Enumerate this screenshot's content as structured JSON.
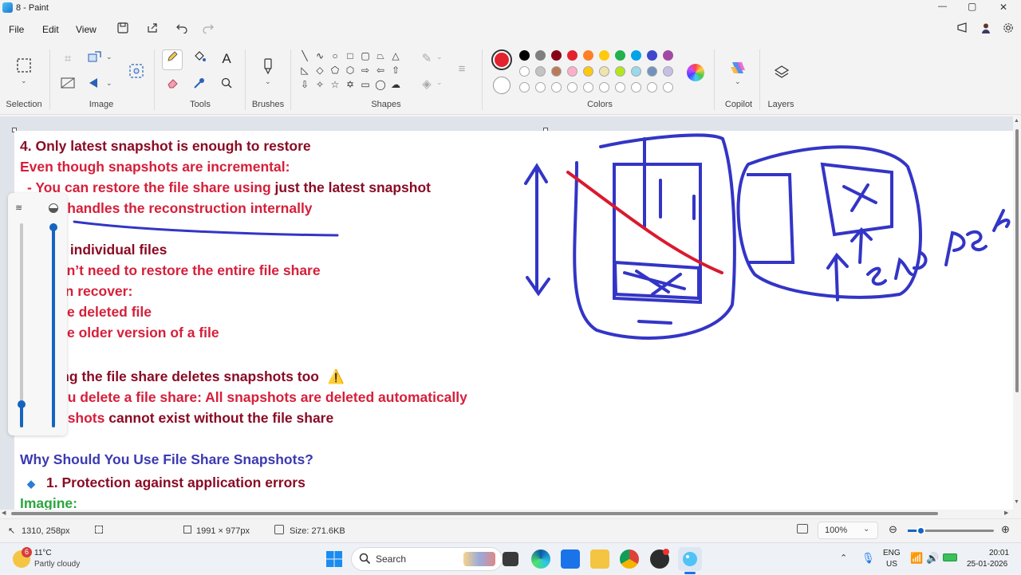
{
  "app": {
    "title": "8 - Paint"
  },
  "window_controls": {
    "minimize": "—",
    "maximize": "▢",
    "close": "✕"
  },
  "menu": {
    "file": "File",
    "edit": "Edit",
    "view": "View"
  },
  "ribbon": {
    "groups": {
      "selection": "Selection",
      "image": "Image",
      "tools": "Tools",
      "brushes": "Brushes",
      "shapes": "Shapes",
      "colors": "Colors",
      "copilot": "Copilot",
      "layers": "Layers"
    },
    "active_color": "#e3222e",
    "palette_row1": [
      "#000000",
      "#7f7f7f",
      "#880015",
      "#e3222e",
      "#ff7f27",
      "#ffc90e",
      "#22b14c",
      "#00a2e8",
      "#3f48cc",
      "#a349a4"
    ],
    "palette_row2": [
      "#ffffff",
      "#c3c3c3",
      "#b97a57",
      "#ffaec9",
      "#ffc90e",
      "#efe4b0",
      "#b5e61d",
      "#99d9ea",
      "#7092be",
      "#c8bfe7"
    ]
  },
  "canvas_text": {
    "l1": "4. Only latest snapshot is enough to restore",
    "l2": "Even though snapshots are incremental:",
    "l3a": "- You can restore the file share using",
    "l3b": " just the latest snapshot",
    "l4": "A    re handles the reconstruction internally",
    "l5": "I      ore individual files",
    "l6": "Y     don’t need to restore the entire file share",
    "l7": "Y     can recover:",
    "l8": "e deleted file",
    "l9": "e older version of a file",
    "l10": "I      eting the file share deletes snapshots too",
    "l10_icon": "⚠️",
    "l11": "ou delete a file share: All snapshots are deleted automatically",
    "l12a": "pshots",
    "l12b": " cannot exist without the file share",
    "l13": "Why Should You Use File Share Snapshots?",
    "l14_bullet": "◆",
    "l14": "1. Protection against application errors",
    "l15": "Imagine:"
  },
  "status": {
    "cursor_pos": "1310, 258px",
    "canvas_size": "1991 × 977px",
    "file_size": "Size: 271.6KB",
    "zoom": "100%"
  },
  "taskbar": {
    "weather_temp": "11°C",
    "weather_desc": "Partly cloudy",
    "weather_badge": "6",
    "search_placeholder": "Search",
    "lang1": "ENG",
    "lang2": "US",
    "time": "20:01",
    "date": "25-01-2026"
  }
}
